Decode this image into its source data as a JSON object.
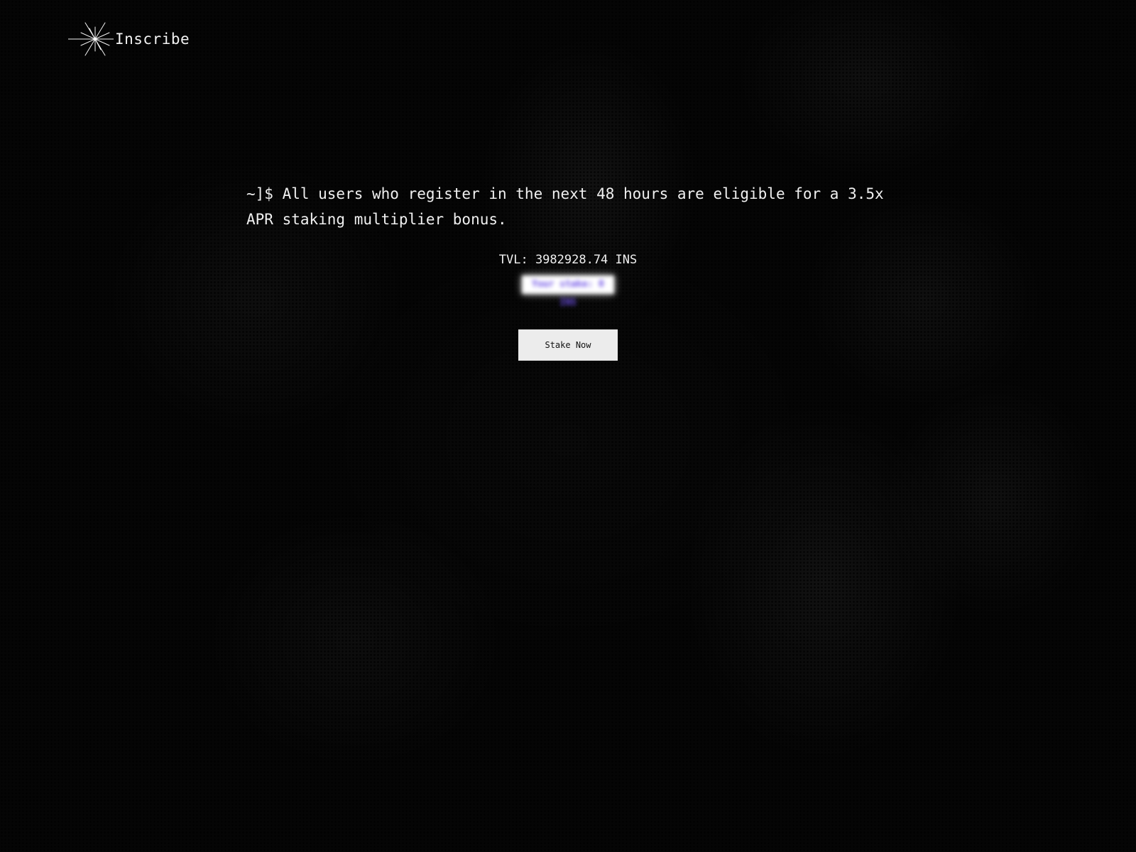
{
  "brand": {
    "name": "Inscribe",
    "icon": "starburst-logo-icon"
  },
  "terminal": {
    "message": "~]$ All users who register in the next 48 hours are eligible for a 3.5x APR staking multiplier bonus."
  },
  "stats": {
    "tvl": "TVL: 3982928.74 INS",
    "user_stake": "Your stake: 0 INS"
  },
  "actions": {
    "stake_label": "Stake Now"
  },
  "colors": {
    "background": "#050505",
    "text": "#f0f0f0",
    "button_bg": "#ececec",
    "stake_accent": "#6b4de6"
  }
}
